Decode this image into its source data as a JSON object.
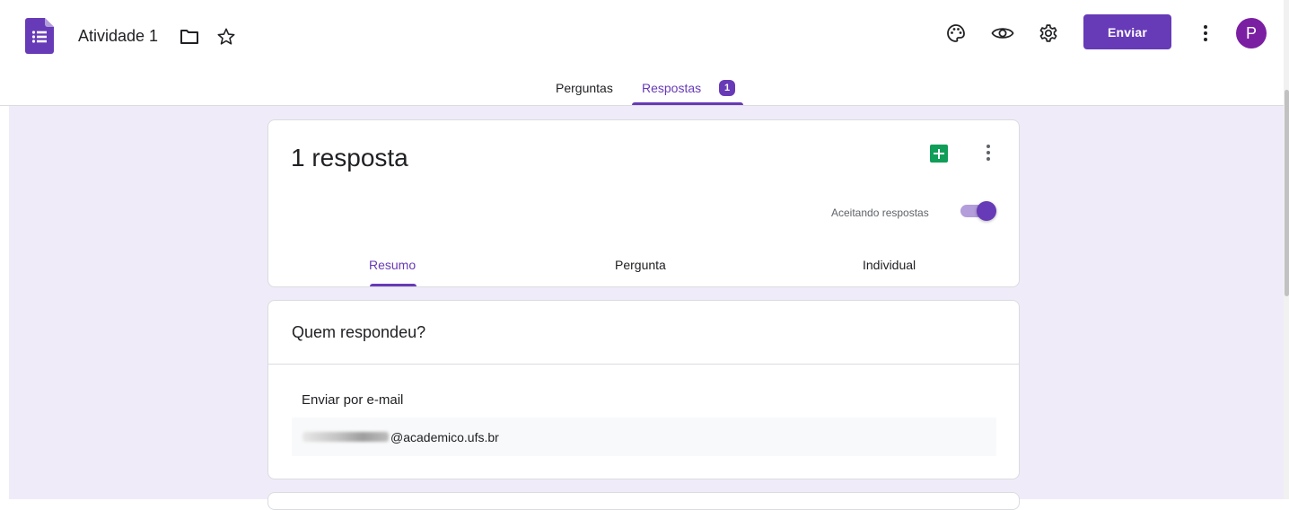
{
  "header": {
    "title": "Atividade 1",
    "send_label": "Enviar",
    "avatar_initial": "P",
    "icons": [
      "forms-logo-icon",
      "folder-icon",
      "star-icon",
      "palette-icon",
      "eye-icon",
      "gear-icon",
      "more-vert-icon"
    ]
  },
  "tabs": {
    "questions_label": "Perguntas",
    "responses_label": "Respostas",
    "responses_badge": "1"
  },
  "summary_card": {
    "count_title": "1 resposta",
    "accepting_label": "Aceitando respostas",
    "accepting_on": true,
    "subtabs": {
      "summary": "Resumo",
      "question": "Pergunta",
      "individual": "Individual"
    }
  },
  "respondents_card": {
    "title": "Quem respondeu?",
    "section_label": "Enviar por e-mail",
    "email_domain": "@academico.ufs.br"
  },
  "colors": {
    "accent": "#673ab7",
    "background": "#f0ebf8",
    "sheets_green": "#0f9d58",
    "avatar": "#7b1fa2"
  }
}
